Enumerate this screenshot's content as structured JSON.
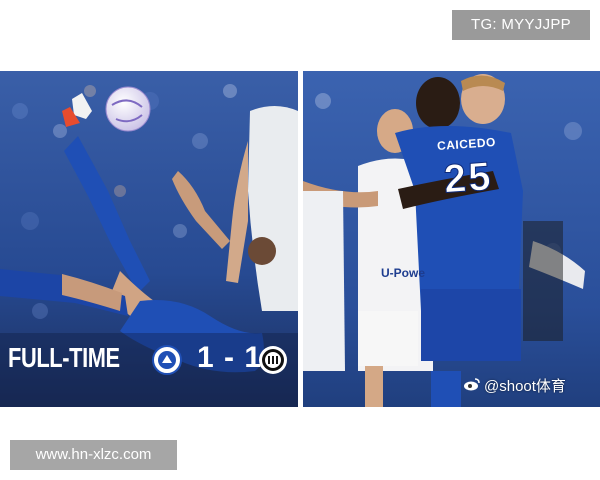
{
  "watermarks": {
    "top_right": "TG: MYYJJPP",
    "bottom_left": "www.hn-xlzc.com",
    "weibo_handle": "@shoot体育"
  },
  "left_photo": {
    "status_text": "FULL-TIME",
    "score": "1 - 1",
    "home_crest_icon": "chelsea-crest-icon",
    "away_crest_icon": "inter-crest-icon"
  },
  "right_photo": {
    "shirt_name": "CAICEDO",
    "shirt_number": "25",
    "away_sponsor": "U-Powe"
  },
  "colors": {
    "chelsea_blue": "#1f4fb5",
    "crowd_blue": "#2a4f9a",
    "watermark_grey": "#9a9a9a"
  }
}
